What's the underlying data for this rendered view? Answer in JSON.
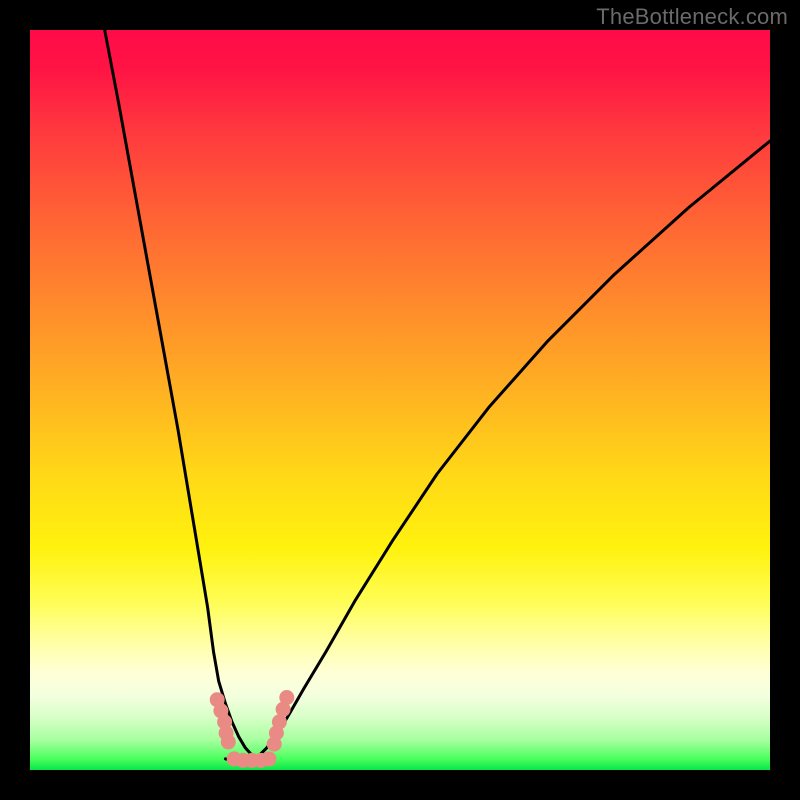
{
  "watermark": "TheBottleneck.com",
  "chart_data": {
    "type": "line",
    "title": "",
    "xlabel": "",
    "ylabel": "",
    "xlim": [
      0,
      100
    ],
    "ylim": [
      0,
      100
    ],
    "legend": false,
    "grid": false,
    "background_gradient": {
      "direction": "vertical",
      "stops": [
        {
          "pos": 0,
          "color": "#ff0b48"
        },
        {
          "pos": 0.25,
          "color": "#ff6235"
        },
        {
          "pos": 0.5,
          "color": "#ffb222"
        },
        {
          "pos": 0.7,
          "color": "#fff20e"
        },
        {
          "pos": 0.87,
          "color": "#ffffd8"
        },
        {
          "pos": 1.0,
          "color": "#07e748"
        }
      ]
    },
    "series": [
      {
        "name": "left-curve",
        "stroke": "#000000",
        "x": [
          10.1,
          12,
          14,
          16,
          18,
          20,
          21,
          22,
          23,
          24,
          24.8,
          25.5,
          26.4,
          27.3,
          28.2,
          29.1,
          30,
          30.5
        ],
        "values": [
          100,
          90,
          79,
          68,
          57,
          46,
          40,
          34,
          28,
          22,
          16,
          12,
          9,
          6.5,
          4.5,
          3,
          2,
          1.7
        ]
      },
      {
        "name": "right-curve",
        "stroke": "#000000",
        "x": [
          30.5,
          31,
          32,
          33.5,
          35,
          37,
          40,
          44,
          49,
          55,
          62,
          70,
          79,
          89,
          100
        ],
        "values": [
          1.7,
          2,
          3,
          5,
          7.5,
          11,
          16,
          23,
          31,
          40,
          49,
          58,
          67,
          76,
          85
        ]
      },
      {
        "name": "flat-bottom",
        "stroke": "#000000",
        "x": [
          26.4,
          28,
          30.5,
          32.5
        ],
        "values": [
          1.5,
          1.2,
          1.2,
          1.7
        ]
      }
    ],
    "markers": [
      {
        "name": "dots-left",
        "color": "#e98b84",
        "points": [
          {
            "x": 25.3,
            "y": 9.5
          },
          {
            "x": 25.8,
            "y": 8.0
          },
          {
            "x": 26.3,
            "y": 6.5
          },
          {
            "x": 26.5,
            "y": 5.0
          },
          {
            "x": 26.8,
            "y": 3.8
          }
        ]
      },
      {
        "name": "dots-bottom",
        "color": "#e98b84",
        "points": [
          {
            "x": 27.6,
            "y": 1.5
          },
          {
            "x": 28.8,
            "y": 1.3
          },
          {
            "x": 30.0,
            "y": 1.3
          },
          {
            "x": 31.2,
            "y": 1.3
          },
          {
            "x": 32.3,
            "y": 1.5
          }
        ]
      },
      {
        "name": "dots-right",
        "color": "#e98b84",
        "points": [
          {
            "x": 33.0,
            "y": 3.5
          },
          {
            "x": 33.3,
            "y": 5.0
          },
          {
            "x": 33.7,
            "y": 6.5
          },
          {
            "x": 34.2,
            "y": 8.2
          },
          {
            "x": 34.7,
            "y": 9.8
          }
        ]
      }
    ]
  }
}
